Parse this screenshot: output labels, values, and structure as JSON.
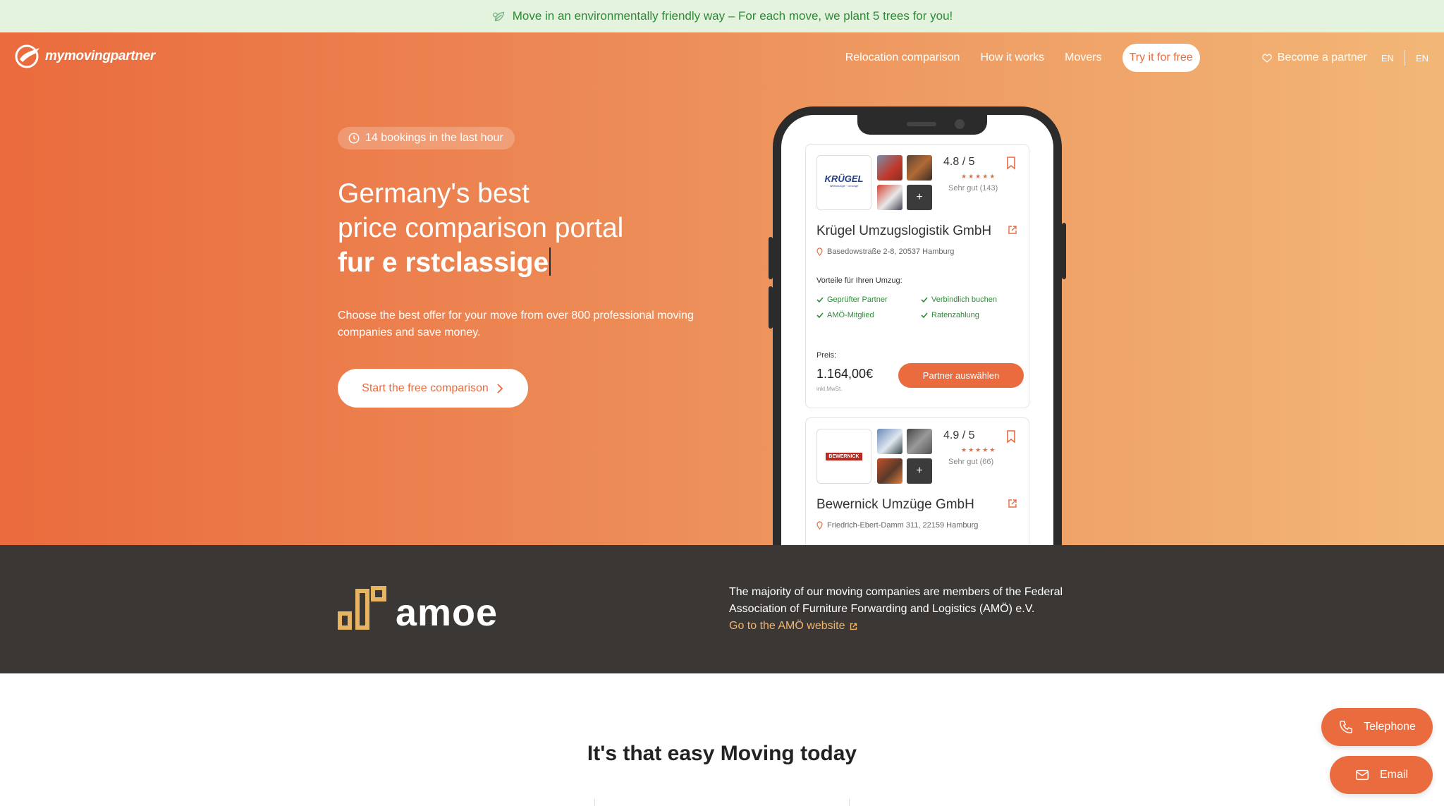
{
  "banner": {
    "icon": "leaf-icon",
    "text": "Move in an environmentally friendly way – For each move, we plant 5 trees for you!",
    "color": "#2d8a38"
  },
  "header": {
    "logo_text": "mymovingpartner",
    "nav": [
      "Relocation comparison",
      "How it works",
      "Movers"
    ],
    "cta": "Try it for free",
    "partner": "Become a partner",
    "lang": "EN",
    "lang2": "EN"
  },
  "hero": {
    "bookings": "14 bookings in the last hour",
    "title_line1": "Germany's best",
    "title_line2": "price comparison portal",
    "title_line3": "fur e rstclassige",
    "subtitle": "Choose the best offer for your move from over 800 professional moving companies and save money.",
    "cta": "Start the free comparison",
    "accent": "#ea6b3d"
  },
  "phone": {
    "cards": [
      {
        "logo": "KRÜGEL",
        "logo_sub": "Weltumzüge · Umzüge",
        "rating": "4.8 / 5",
        "stars": "★★★★★",
        "rating_text": "Sehr gut (143)",
        "name": "Krügel Umzugslogistik GmbH",
        "address": "Basedowstraße 2-8, 20537 Hamburg",
        "advantages_title": "Vorteile für Ihren Umzug:",
        "advantages": [
          "Geprüfter Partner",
          "Verbindlich buchen",
          "AMÖ-Mitglied",
          "Ratenzahlung"
        ],
        "price_label": "Preis:",
        "price": "1.164,00€",
        "vat": "inkl.MwSt.",
        "button": "Partner auswählen",
        "plus": "+"
      },
      {
        "logo": "BEWERNICK",
        "rating": "4.9 / 5",
        "stars": "★★★★★",
        "rating_text": "Sehr gut (66)",
        "name": "Bewernick Umzüge GmbH",
        "address": "Friedrich-Ebert-Damm 311, 22159 Hamburg",
        "plus": "+"
      }
    ]
  },
  "amoe": {
    "logo_text": "amoe",
    "description": "The majority of our moving companies are members of the Federal Association of Furniture Forwarding and Logistics (AMÖ) e.V.",
    "link": "Go to the AMÖ website"
  },
  "section": {
    "title_regular": "It's that easy",
    "title_bold": "Moving today"
  },
  "contact": {
    "telephone": "Telephone",
    "email": "Email"
  }
}
